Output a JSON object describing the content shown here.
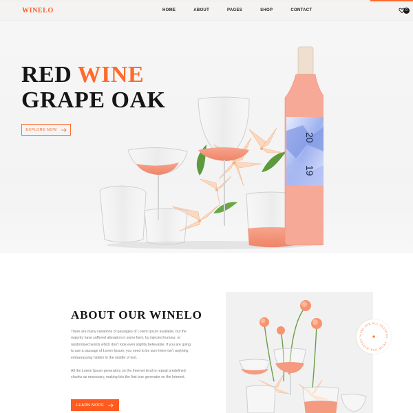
{
  "brand": {
    "logo": "WINELO",
    "accent": "#ff6a2b"
  },
  "nav": {
    "items": [
      "HOME",
      "ABOUT",
      "PAGES",
      "SHOP",
      "CONTACT"
    ]
  },
  "cart": {
    "count": "0",
    "icon": "heart-bag-icon"
  },
  "hero": {
    "title_line1_a": "RED ",
    "title_line1_b": "WINE",
    "title_line2": "GRAPE OAK",
    "button_label": "EXPLORE NOW",
    "bottle_label_top": "20",
    "bottle_label_bottom": "19"
  },
  "about": {
    "title": "ABOUT OUR WINELO",
    "paragraph1": "There are many variations of passages of Lorem Ipsum available, but the majority have suffered alteration in some form, by injected humour, or randomised words which don't look even slightly believable. If you are going to use a passage of Lorem Ipsum, you need to be sure there isn't anything embarrassing hidden in the middle of text.",
    "paragraph2": "All the Lorem Ipsum generators on the Internet tend to repeat predefined chunks as necessary, making this the first true generator on the Internet.",
    "button_label": "LEARN MORE",
    "badge_text": "WINE FOR ALL SEASONS · FROM OUR WINERY ·"
  }
}
